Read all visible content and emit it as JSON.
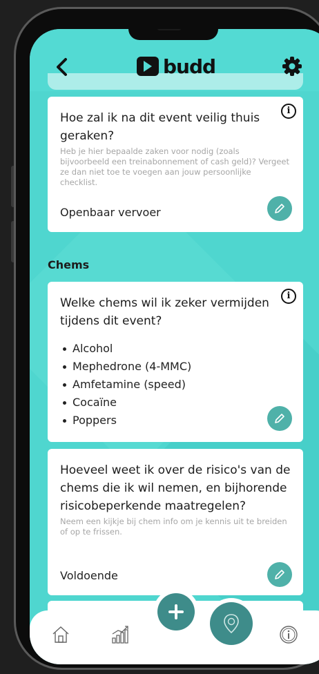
{
  "app": {
    "logo_text": "budd"
  },
  "cards": [
    {
      "title": "Hoe zal ik na dit event veilig thuis geraken?",
      "description": "Heb je hier bepaalde zaken voor nodig (zoals bijvoorbeeld een treinabonnement of cash geld)? Vergeet ze dan niet toe te voegen aan jouw persoonlijke checklist.",
      "answer": "Openbaar vervoer"
    },
    {
      "title": "Welke chems wil ik zeker vermijden tijdens dit event?",
      "items": [
        "Alcohol",
        "Mephedrone (4-MMC)",
        "Amfetamine (speed)",
        "Cocaïne",
        "Poppers"
      ]
    },
    {
      "title": "Hoeveel weet ik over de risico's van de chems die ik wil nemen, en bijhorende risicobeperkende maatregelen?",
      "description": "Neem een kijkje bij chem info om je kennis uit te breiden of op te frissen.",
      "answer": "Voldoende"
    }
  ],
  "section": {
    "title": "Chems"
  },
  "icons": {
    "back": "back-arrow-icon",
    "settings": "gear-icon",
    "info": "info-icon",
    "edit": "pencil-icon",
    "home": "home-icon",
    "stats": "chart-icon",
    "add": "plus-icon",
    "map": "map-pin-icon",
    "about": "info-circle-icon"
  },
  "colors": {
    "background": "#4fd6cf",
    "accent": "#3e8c8a",
    "edit_button": "#4fb1a9"
  }
}
